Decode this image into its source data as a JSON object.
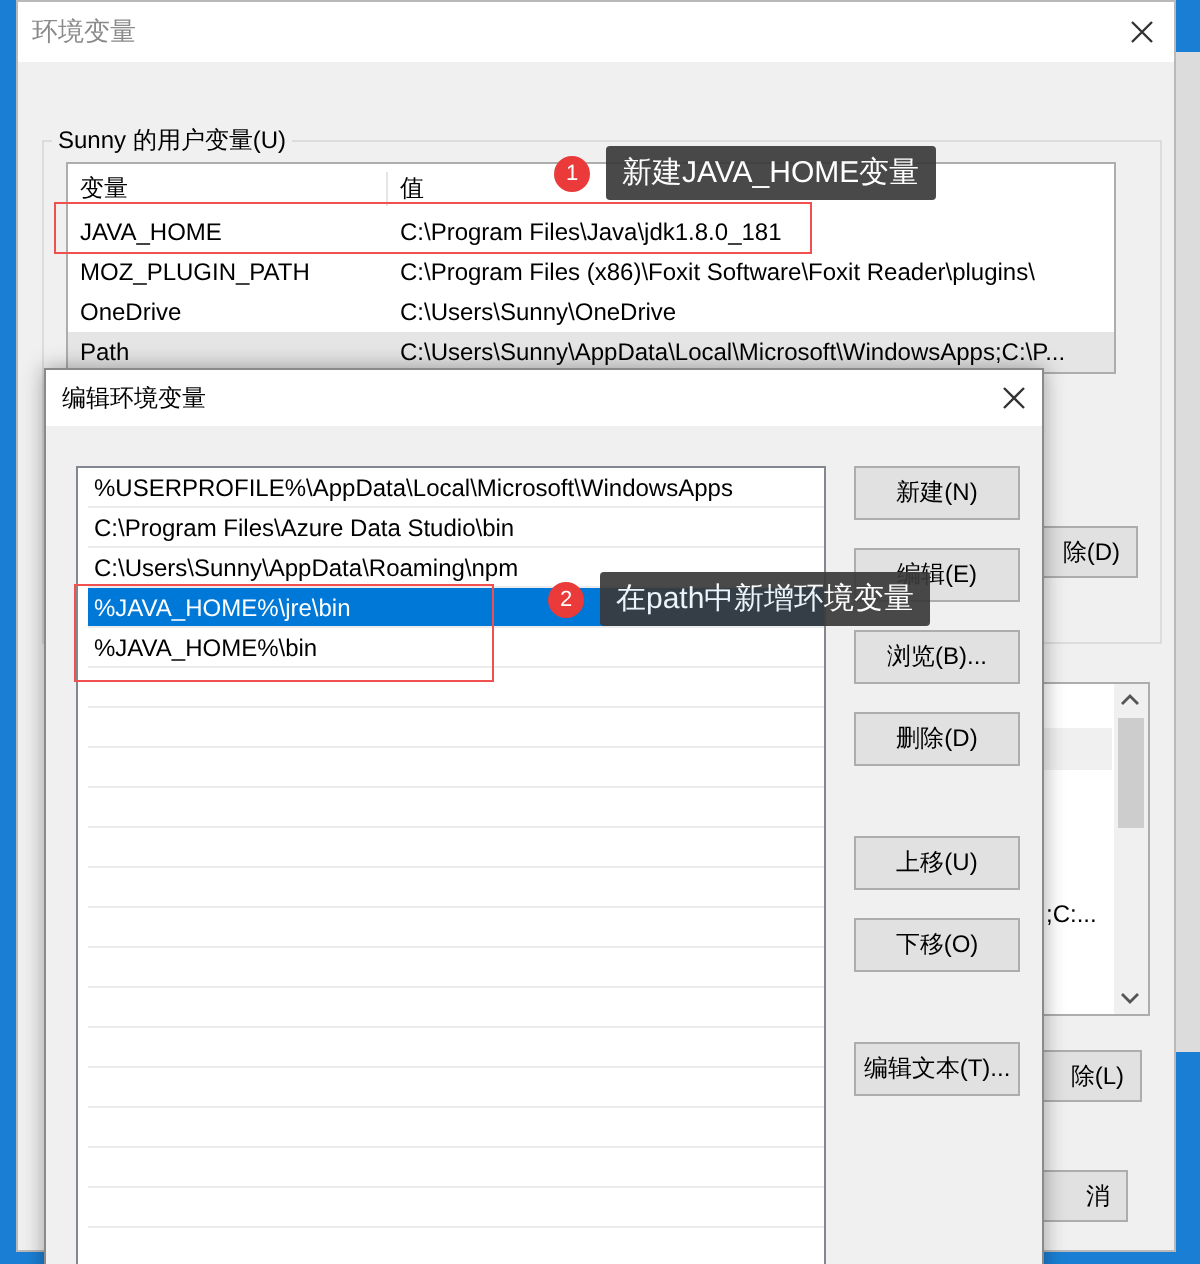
{
  "back_window": {
    "title": "环境变量",
    "group_label": "Sunny 的用户变量(U)",
    "columns": [
      "变量",
      "值"
    ],
    "rows": [
      {
        "name": "JAVA_HOME",
        "value": "C:\\Program Files\\Java\\jdk1.8.0_181",
        "selected": false
      },
      {
        "name": "MOZ_PLUGIN_PATH",
        "value": "C:\\Program Files (x86)\\Foxit Software\\Foxit Reader\\plugins\\",
        "selected": false
      },
      {
        "name": "OneDrive",
        "value": "C:\\Users\\Sunny\\OneDrive",
        "selected": false
      },
      {
        "name": "Path",
        "value": "C:\\Users\\Sunny\\AppData\\Local\\Microsoft\\WindowsApps;C:\\P...",
        "selected": true
      }
    ],
    "user_delete_button": "除(D)",
    "system_list_text": ";C:...",
    "system_delete_button": "除(L)",
    "cancel_button": "消"
  },
  "front_window": {
    "title": "编辑环境变量",
    "entries": [
      {
        "text": "%USERPROFILE%\\AppData\\Local\\Microsoft\\WindowsApps",
        "selected": false
      },
      {
        "text": "C:\\Program Files\\Azure Data Studio\\bin",
        "selected": false
      },
      {
        "text": "C:\\Users\\Sunny\\AppData\\Roaming\\npm",
        "selected": false
      },
      {
        "text": "%JAVA_HOME%\\jre\\bin",
        "selected": true
      },
      {
        "text": "%JAVA_HOME%\\bin",
        "selected": false
      }
    ],
    "button_groups": [
      [
        "新建(N)",
        "编辑(E)",
        "浏览(B)...",
        "删除(D)"
      ],
      [
        "上移(U)",
        "下移(O)"
      ],
      [
        "编辑文本(T)..."
      ]
    ]
  },
  "annotations": [
    {
      "number": "1",
      "text": "新建JAVA_HOME变量"
    },
    {
      "number": "2",
      "text": "在path中新增环境变量"
    }
  ]
}
